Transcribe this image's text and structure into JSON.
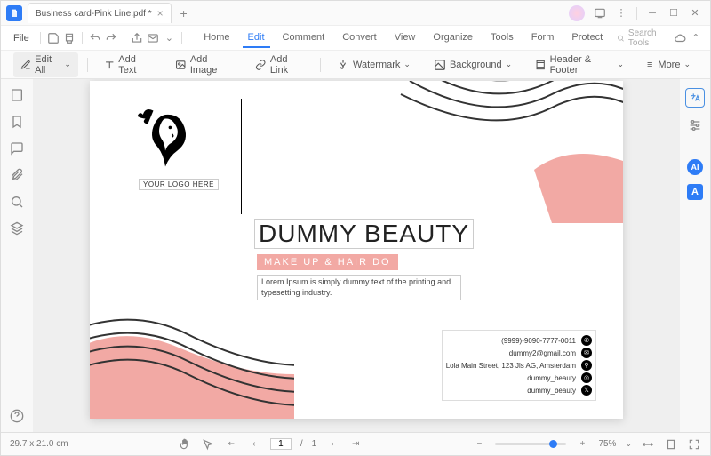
{
  "titlebar": {
    "tab_title": "Business card-Pink Line.pdf *"
  },
  "menubar": {
    "file": "File",
    "tabs": {
      "home": "Home",
      "edit": "Edit",
      "comment": "Comment",
      "convert": "Convert",
      "view": "View",
      "organize": "Organize",
      "tools": "Tools",
      "form": "Form",
      "protect": "Protect"
    },
    "search_placeholder": "Search Tools"
  },
  "toolbar": {
    "edit_all": "Edit All",
    "add_text": "Add Text",
    "add_image": "Add Image",
    "add_link": "Add Link",
    "watermark": "Watermark",
    "background": "Background",
    "header_footer": "Header & Footer",
    "more": "More"
  },
  "right_rail": {
    "ai": "AI",
    "a_btn": "A"
  },
  "document": {
    "logo_caption": "YOUR LOGO HERE",
    "title": "DUMMY BEAUTY",
    "subtitle": "MAKE UP & HAIR DO",
    "body": "Lorem Ipsum is simply dummy text of the printing and typesetting industry.",
    "contact": {
      "phone": "(9999)-9090-7777-0011",
      "email": "dummy2@gmail.com",
      "address": "Lola Main Street, 123 Jls AG, Amsterdam",
      "instagram": "dummy_beauty",
      "twitter": "dummy_beauty"
    }
  },
  "statusbar": {
    "dimensions": "29.7 x 21.0 cm",
    "page_current": "1",
    "page_sep": "/",
    "page_total": "1",
    "zoom": "75%"
  }
}
